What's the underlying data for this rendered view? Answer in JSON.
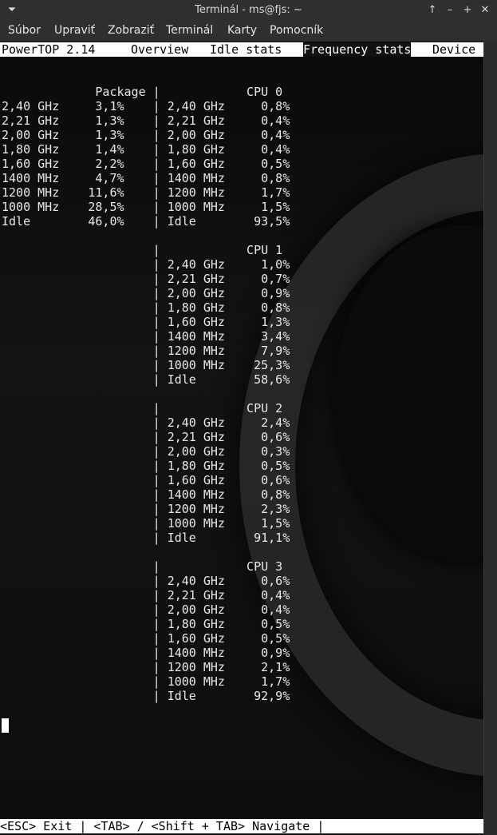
{
  "window": {
    "title": "Terminál - ms@fjs: ~",
    "menu_glyph": "⏷",
    "up_glyph": "↑",
    "min_glyph": "–",
    "max_glyph": "+",
    "close_glyph": "✕"
  },
  "menu": [
    "Súbor",
    "Upraviť",
    "Zobraziť",
    "Terminál",
    "Karty",
    "Pomocník"
  ],
  "app": {
    "name": "PowerTOP 2.14",
    "tabs": [
      "Overview",
      "Idle stats",
      "Frequency stats",
      "Device"
    ],
    "active_tab": "Frequency stats"
  },
  "lines": [
    "",
    "             Package |            CPU 0",
    "2,40 GHz     3,1%    | 2,40 GHz     0,8%",
    "2,21 GHz     1,3%    | 2,21 GHz     0,4%",
    "2,00 GHz     1,3%    | 2,00 GHz     0,4%",
    "1,80 GHz     1,4%    | 1,80 GHz     0,4%",
    "1,60 GHz     2,2%    | 1,60 GHz     0,5%",
    "1400 MHz     4,7%    | 1400 MHz     0,8%",
    "1200 MHz    11,6%    | 1200 MHz     1,7%",
    "1000 MHz    28,5%    | 1000 MHz     1,5%",
    "Idle        46,0%    | Idle        93,5%",
    "",
    "                     |            CPU 1",
    "                     | 2,40 GHz     1,0%",
    "                     | 2,21 GHz     0,7%",
    "                     | 2,00 GHz     0,9%",
    "                     | 1,80 GHz     0,8%",
    "                     | 1,60 GHz     1,3%",
    "                     | 1400 MHz     3,4%",
    "                     | 1200 MHz     7,9%",
    "                     | 1000 MHz    25,3%",
    "                     | Idle        58,6%",
    "",
    "                     |            CPU 2",
    "                     | 2,40 GHz     2,4%",
    "                     | 2,21 GHz     0,6%",
    "                     | 2,00 GHz     0,3%",
    "                     | 1,80 GHz     0,5%",
    "                     | 1,60 GHz     0,6%",
    "                     | 1400 MHz     0,8%",
    "                     | 1200 MHz     2,3%",
    "                     | 1000 MHz     1,5%",
    "                     | Idle        91,1%",
    "",
    "                     |            CPU 3",
    "                     | 2,40 GHz     0,6%",
    "                     | 2,21 GHz     0,4%",
    "                     | 2,00 GHz     0,4%",
    "                     | 1,80 GHz     0,5%",
    "                     | 1,60 GHz     0,5%",
    "                     | 1400 MHz     0,9%",
    "                     | 1200 MHz     2,1%",
    "                     | 1000 MHz     1,7%",
    "                     | Idle        92,9%"
  ],
  "footer": "<ESC> Exit | <TAB> / <Shift + TAB> Navigate |"
}
